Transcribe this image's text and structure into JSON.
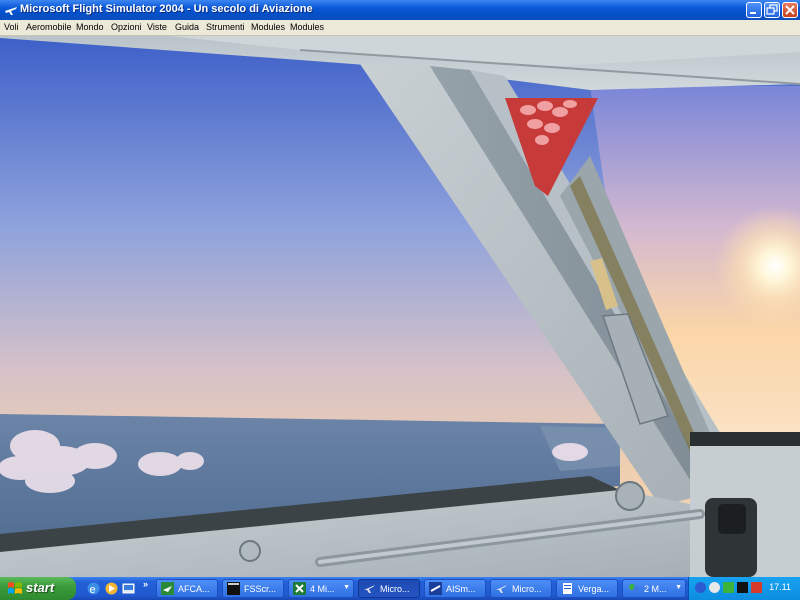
{
  "window": {
    "title": "Microsoft Flight Simulator 2004 - Un secolo di Aviazione"
  },
  "menu": {
    "items": [
      "Voli",
      "Aeromobile",
      "Mondo",
      "Opzioni",
      "Viste",
      "Guida",
      "Strumenti",
      "Modules",
      "Modules"
    ]
  },
  "taskbar": {
    "start_label": "start",
    "quick_launch_more": "»",
    "tasks": [
      {
        "label": "AFCA...",
        "icon": "plane-app-icon",
        "active": false
      },
      {
        "label": "FSScr...",
        "icon": "terminal-icon",
        "active": false
      },
      {
        "label": "4 Mi...",
        "icon": "excel-icon",
        "active": false
      },
      {
        "label": "Micro...",
        "icon": "flight-sim-icon",
        "active": true
      },
      {
        "label": "AISm...",
        "icon": "ai-smooth-icon",
        "active": false
      },
      {
        "label": "Micro...",
        "icon": "flight-sim-icon",
        "active": false
      },
      {
        "label": "Verga...",
        "icon": "document-icon",
        "active": false
      },
      {
        "label": "2 M...",
        "icon": "messenger-icon",
        "active": false
      }
    ],
    "clock": "17.11"
  },
  "colors": {
    "title_bar": "#0550c8",
    "taskbar": "#2462d8",
    "start_button": "#3a9d3a",
    "tray": "#0d8de0"
  }
}
